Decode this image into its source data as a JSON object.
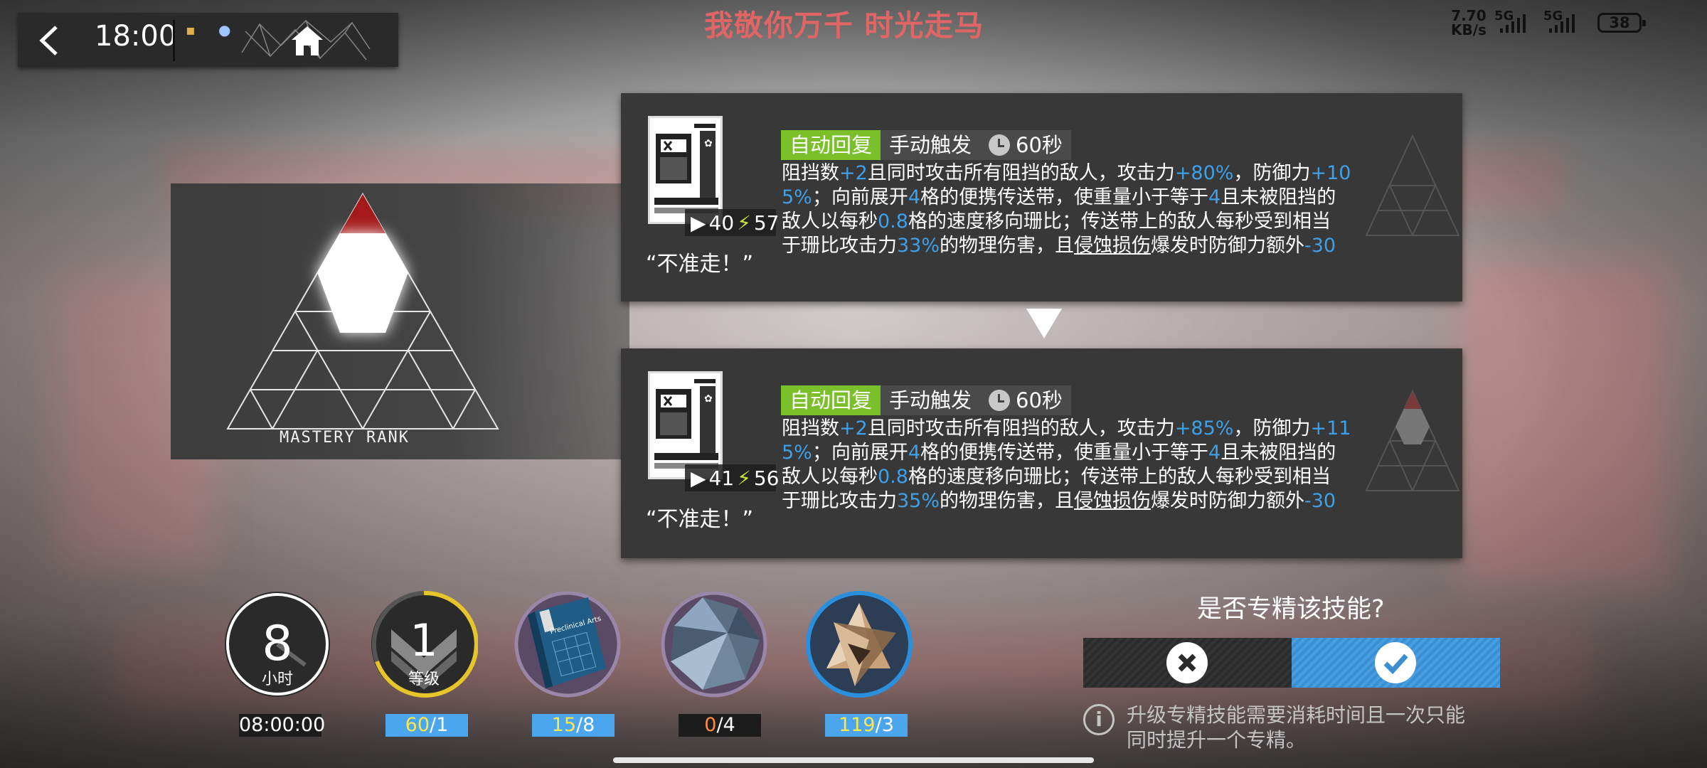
{
  "status_bar": {
    "time": "18:00",
    "net_speed_value": "7.70",
    "net_speed_unit": "KB/s",
    "sim1": "5G",
    "sim2": "5G",
    "battery": "38"
  },
  "banner": "我敬你万千 时光走马",
  "mastery": {
    "label": "MASTERY RANK",
    "level_highlighted": 1,
    "levels": 3
  },
  "skills": [
    {
      "recovery": "自动回复",
      "trigger": "手动触发",
      "duration": "60秒",
      "initial_sp": "40",
      "sp_cost": "57",
      "quote": "“不准走！”",
      "desc": {
        "p1": "阻挡数",
        "v1": "+2",
        "p2": "且同时攻击所有阻挡的敌人，攻击力",
        "v2": "+80%",
        "p3": "，防御力",
        "v3a": "+10",
        "v3b": "5%",
        "p4": "；向前展开",
        "v4": "4",
        "p5": "格的便携传送带，使重量小于等于",
        "v5": "4",
        "p6": "且未被阻挡的",
        "p7": "敌人以每秒",
        "v6": "0.8",
        "p8": "格的速度移向珊比；传送带上的敌人每秒受到相当",
        "p9": "于珊比攻击力",
        "v7": "33%",
        "p10": "的物理伤害，且",
        "term": "侵蚀损伤",
        "p11": "爆发时防御力额外",
        "v8": "-30"
      }
    },
    {
      "recovery": "自动回复",
      "trigger": "手动触发",
      "duration": "60秒",
      "initial_sp": "41",
      "sp_cost": "56",
      "quote": "“不准走！”",
      "desc": {
        "p1": "阻挡数",
        "v1": "+2",
        "p2": "且同时攻击所有阻挡的敌人，攻击力",
        "v2": "+85%",
        "p3": "，防御力",
        "v3a": "+11",
        "v3b": "5%",
        "p4": "；向前展开",
        "v4": "4",
        "p5": "格的便携传送带，使重量小于等于",
        "v5": "4",
        "p6": "且未被阻挡的",
        "p7": "敌人以每秒",
        "v6": "0.8",
        "p8": "格的速度移向珊比；传送带上的敌人每秒受到相当",
        "p9": "于珊比攻击力",
        "v7": "35%",
        "p10": "的物理伤害，且",
        "term": "侵蚀损伤",
        "p11": "爆发时防御力额外",
        "v8": "-30"
      }
    }
  ],
  "requirements": [
    {
      "icon": "hourglass-timer-icon",
      "big": "8",
      "small": "小时",
      "value": "08:00:00"
    },
    {
      "icon": "level-chevron-icon",
      "big": "1",
      "small": "等级",
      "have": "60",
      "need": "/1"
    },
    {
      "icon": "skill-book-icon",
      "book_title": "Preclinical Arts",
      "have": "15",
      "need": "/8"
    },
    {
      "icon": "crystal-material-icon",
      "have": "0",
      "need": "/4"
    },
    {
      "icon": "gold-alloy-material-icon",
      "have": "119",
      "need": "/3"
    }
  ],
  "confirm": {
    "question": "是否专精该技能?",
    "info_line1": "升级专精技能需要消耗时间且一次只能",
    "info_line2": "同时提升一个专精。"
  },
  "colors": {
    "accent_blue": "#3ea0e8",
    "tag_green": "#7bbf2a",
    "banner_red": "#e06565",
    "stock_yellow": "#fde64a"
  }
}
